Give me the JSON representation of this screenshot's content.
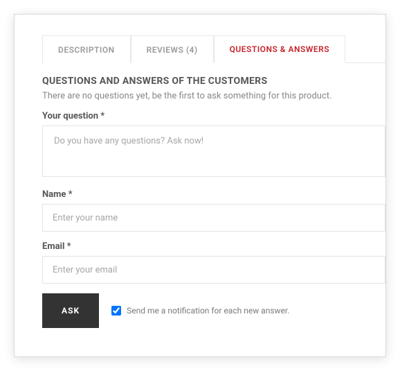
{
  "tabs": [
    {
      "label": "DESCRIPTION"
    },
    {
      "label": "REVIEWS (4)"
    },
    {
      "label": "QUESTIONS & ANSWERS"
    }
  ],
  "section_title": "QUESTIONS AND ANSWERS OF THE CUSTOMERS",
  "empty_message": "There are no questions yet, be the first to ask something for this product.",
  "form": {
    "question_label": "Your question *",
    "question_placeholder": "Do you have any questions? Ask now!",
    "name_label": "Name *",
    "name_placeholder": "Enter your name",
    "email_label": "Email *",
    "email_placeholder": "Enter your email",
    "submit_label": "ASK",
    "notify_label": "Send me a notification for each new answer.",
    "notify_checked": true
  }
}
